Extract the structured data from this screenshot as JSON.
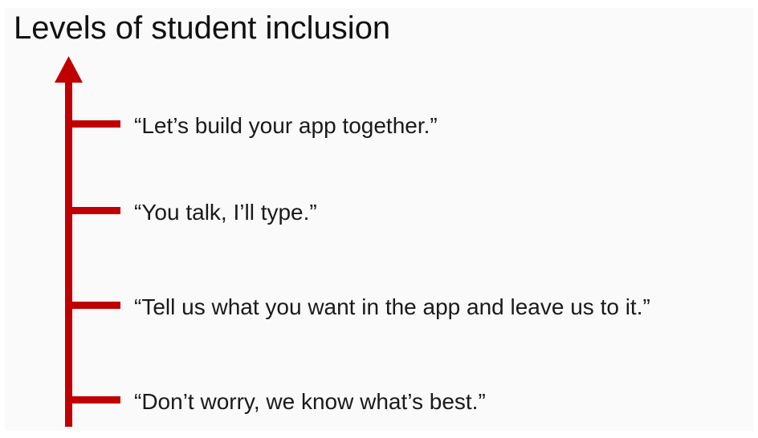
{
  "title": "Levels of student inclusion",
  "axis": {
    "color": "#c00000"
  },
  "levels": [
    {
      "label": "“Let’s build your app together.”"
    },
    {
      "label": "“You talk, I’ll type.”"
    },
    {
      "label": "“Tell us what you want in the app and leave us to it.”"
    },
    {
      "label": "“Don’t worry, we know what’s best.”"
    }
  ]
}
